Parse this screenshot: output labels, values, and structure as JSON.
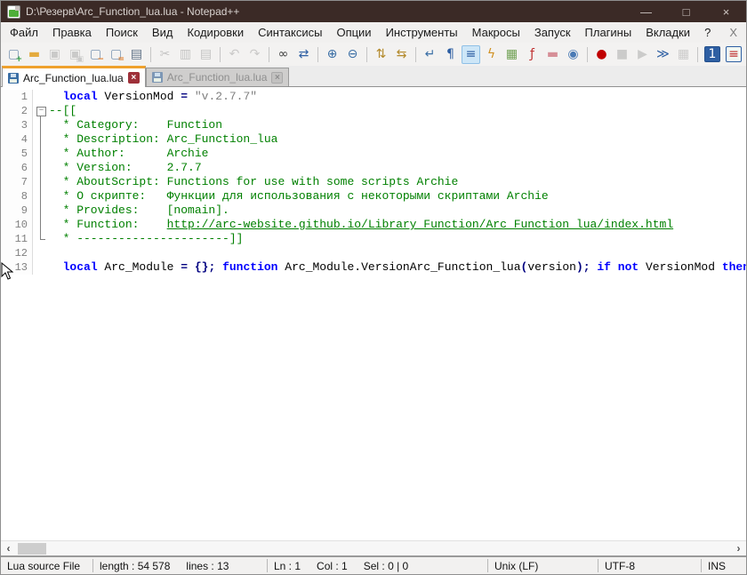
{
  "titlebar": {
    "title": "D:\\Резерв\\Arc_Function_lua.lua - Notepad++",
    "minimize": "—",
    "maximize": "□",
    "close": "×"
  },
  "menubar": {
    "items": [
      "Файл",
      "Правка",
      "Поиск",
      "Вид",
      "Кодировки",
      "Синтаксисы",
      "Опции",
      "Инструменты",
      "Макросы",
      "Запуск",
      "Плагины",
      "Вкладки",
      "?"
    ],
    "doc_close": "X"
  },
  "toolbar": {
    "overflow": "›",
    "buttons": [
      {
        "name": "new-file",
        "state": "normal"
      },
      {
        "name": "open-file",
        "state": "normal"
      },
      {
        "name": "save",
        "state": "disabled"
      },
      {
        "name": "save-all",
        "state": "disabled"
      },
      {
        "name": "close-file",
        "state": "normal"
      },
      {
        "name": "close-all",
        "state": "normal"
      },
      {
        "name": "print",
        "state": "normal"
      },
      {
        "type": "separator"
      },
      {
        "name": "cut",
        "state": "disabled"
      },
      {
        "name": "copy",
        "state": "disabled"
      },
      {
        "name": "paste",
        "state": "disabled"
      },
      {
        "type": "separator"
      },
      {
        "name": "undo",
        "state": "disabled"
      },
      {
        "name": "redo",
        "state": "disabled"
      },
      {
        "type": "separator"
      },
      {
        "name": "find",
        "state": "normal"
      },
      {
        "name": "replace",
        "state": "normal"
      },
      {
        "type": "separator"
      },
      {
        "name": "zoom-in",
        "state": "normal"
      },
      {
        "name": "zoom-out",
        "state": "normal"
      },
      {
        "type": "separator"
      },
      {
        "name": "sync-vertical-scroll",
        "state": "normal"
      },
      {
        "name": "sync-horizontal-scroll",
        "state": "normal"
      },
      {
        "type": "separator"
      },
      {
        "name": "word-wrap",
        "state": "normal"
      },
      {
        "name": "show-all-characters",
        "state": "normal"
      },
      {
        "name": "show-indent-guide",
        "state": "selected"
      },
      {
        "name": "user-defined-dialog",
        "state": "normal"
      },
      {
        "name": "document-map",
        "state": "normal"
      },
      {
        "name": "function-list",
        "state": "normal"
      },
      {
        "name": "folder-as-workspace",
        "state": "normal"
      },
      {
        "name": "view-monitoring",
        "state": "normal"
      },
      {
        "type": "separator"
      },
      {
        "name": "macro-record",
        "state": "normal"
      },
      {
        "name": "macro-stop",
        "state": "disabled"
      },
      {
        "name": "macro-play",
        "state": "disabled"
      },
      {
        "name": "macro-run-multiple",
        "state": "normal"
      },
      {
        "name": "macro-save",
        "state": "disabled"
      },
      {
        "type": "separator"
      },
      {
        "name": "plugin-button-1",
        "state": "normal"
      },
      {
        "name": "plugin-button-2",
        "state": "normal"
      }
    ]
  },
  "tabbar": {
    "tabs": [
      {
        "label": "Arc_Function_lua.lua",
        "state": "active",
        "close": "×"
      },
      {
        "label": "Arc_Function_lua.lua",
        "state": "inactive",
        "close": "×"
      }
    ]
  },
  "editor": {
    "lines": [
      {
        "num": "1",
        "fold": "",
        "segments": [
          {
            "text": "  ",
            "style": "plain"
          },
          {
            "text": "local",
            "style": "keyword"
          },
          {
            "text": " VersionMod ",
            "style": "plain"
          },
          {
            "text": "= ",
            "style": "operator"
          },
          {
            "text": "\"v.2.7.7\"",
            "style": "string"
          }
        ]
      },
      {
        "num": "2",
        "fold": "start",
        "segments": [
          {
            "text": "--[[",
            "style": "comment"
          }
        ]
      },
      {
        "num": "3",
        "fold": "line",
        "segments": [
          {
            "text": "  * Category:    Function",
            "style": "comment"
          }
        ]
      },
      {
        "num": "4",
        "fold": "line",
        "segments": [
          {
            "text": "  * Description: Arc_Function_lua",
            "style": "comment"
          }
        ]
      },
      {
        "num": "5",
        "fold": "line",
        "segments": [
          {
            "text": "  * Author:      Archie",
            "style": "comment"
          }
        ]
      },
      {
        "num": "6",
        "fold": "line",
        "segments": [
          {
            "text": "  * Version:     2.7.7",
            "style": "comment"
          }
        ]
      },
      {
        "num": "7",
        "fold": "line",
        "segments": [
          {
            "text": "  * AboutScript: Functions for use with some scripts Archie",
            "style": "comment"
          }
        ]
      },
      {
        "num": "8",
        "fold": "line",
        "segments": [
          {
            "text": "  * О скрипте:   Функции для использования с некоторыми скриптами Archie",
            "style": "comment"
          }
        ]
      },
      {
        "num": "9",
        "fold": "line",
        "segments": [
          {
            "text": "  * Provides:    [nomain].",
            "style": "comment"
          }
        ]
      },
      {
        "num": "10",
        "fold": "line",
        "segments": [
          {
            "text": "  * Function:    ",
            "style": "comment"
          },
          {
            "text": "http://arc-website.github.io/Library_Function/Arc_Function_lua/index.html",
            "style": "link"
          }
        ]
      },
      {
        "num": "11",
        "fold": "end",
        "segments": [
          {
            "text": "  * ----------------------]]",
            "style": "comment"
          }
        ]
      },
      {
        "num": "12",
        "fold": "",
        "segments": []
      },
      {
        "num": "13",
        "fold": "",
        "segments": [
          {
            "text": "  ",
            "style": "plain"
          },
          {
            "text": "local",
            "style": "keyword"
          },
          {
            "text": " Arc_Module ",
            "style": "plain"
          },
          {
            "text": "= {}; ",
            "style": "operator"
          },
          {
            "text": "function",
            "style": "keyword"
          },
          {
            "text": " Arc_Module.VersionArc_Function_lua",
            "style": "plain"
          },
          {
            "text": "(",
            "style": "operator"
          },
          {
            "text": "version",
            "style": "plain"
          },
          {
            "text": "); ",
            "style": "operator"
          },
          {
            "text": "if",
            "style": "keyword"
          },
          {
            "text": " ",
            "style": "plain"
          },
          {
            "text": "not",
            "style": "keyword"
          },
          {
            "text": " VersionMod ",
            "style": "plain"
          },
          {
            "text": "then",
            "style": "keyword"
          }
        ]
      }
    ]
  },
  "hscrollbar": {
    "left_arrow": "‹",
    "right_arrow": "›"
  },
  "statusbar": {
    "doctype": "Lua source File",
    "length": "length : 54 578",
    "lines": "lines : 13",
    "ln": "Ln : 1",
    "col": "Col : 1",
    "sel": "Sel : 0 | 0",
    "eol": "Unix (LF)",
    "encoding": "UTF-8",
    "mode": "INS"
  },
  "colors": {
    "titlebar_bg": "#3b2a26",
    "active_tab_accent": "#efa12d",
    "keyword": "#0000ff",
    "comment": "#008000",
    "string": "#808080",
    "operator": "#000080",
    "record_red": "#c00000"
  }
}
